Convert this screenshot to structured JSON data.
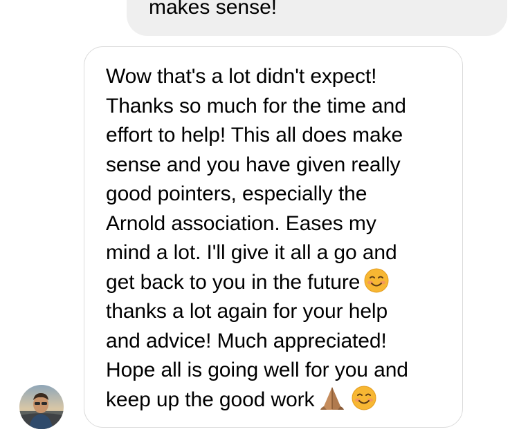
{
  "thread": {
    "previous_message": {
      "text": "makes sense!"
    },
    "reply": {
      "lines": [
        "Wow that's a lot didn't expect!",
        "Thanks so much for the time and",
        "effort to help! This all does make",
        "sense and you have given really",
        "good pointers, especially the",
        "Arnold association. Eases my",
        "mind a lot. I'll give it all a go and",
        "get back to you in the future",
        "thanks a lot again for your help",
        "and advice! Much appreciated!",
        "Hope all is going well for you and",
        "keep up the good work"
      ],
      "icons": {
        "smile": "smiling-face-emoji",
        "pray": "folded-hands-emoji"
      }
    },
    "sender": {
      "avatar_icon": "profile-photo"
    }
  },
  "colors": {
    "sent_bubble": "#efefef",
    "reply_border": "#dbdbdb",
    "emoji_yellow": "#f7b733"
  }
}
